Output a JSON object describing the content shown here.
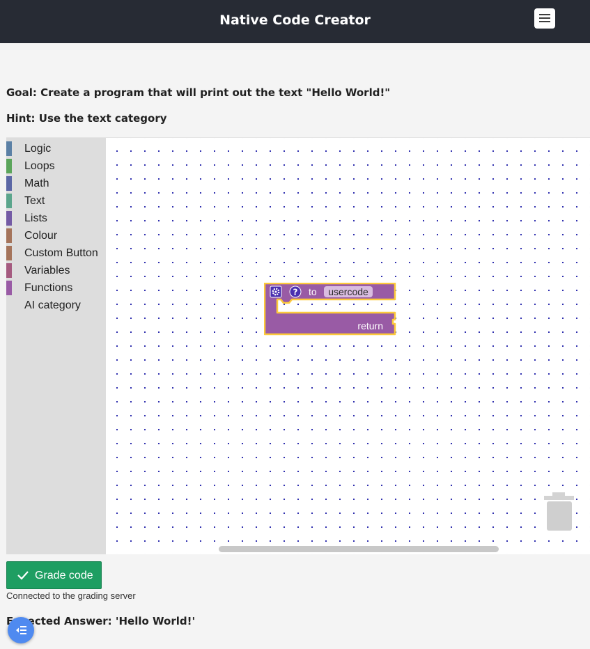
{
  "header": {
    "title": "Native Code Creator",
    "menu_icon": "hamburger-menu-icon"
  },
  "goal_text": "Goal: Create a program that will print out the text \"Hello World!\"",
  "hint_text": "Hint: Use the text category",
  "toolbox": {
    "categories": [
      {
        "label": "Logic",
        "color": "#5b80a5"
      },
      {
        "label": "Loops",
        "color": "#5ba55b"
      },
      {
        "label": "Math",
        "color": "#5b67a5"
      },
      {
        "label": "Text",
        "color": "#5ba58c"
      },
      {
        "label": "Lists",
        "color": "#745ba5"
      },
      {
        "label": "Colour",
        "color": "#a5745b"
      },
      {
        "label": "Custom Button",
        "color": "#a5745b"
      },
      {
        "label": "Variables",
        "color": "#a55b80"
      },
      {
        "label": "Functions",
        "color": "#995ba5"
      },
      {
        "label": "AI category",
        "color": ""
      }
    ]
  },
  "function_block": {
    "keyword": "to",
    "name": "usercode",
    "return_label": "return",
    "color": "#995ba5",
    "highlight": "#fcc93b"
  },
  "grade_button": {
    "label": "Grade code",
    "color": "#1e9e62"
  },
  "status_text": "Connected to the grading server",
  "expected_answer": "Expected Answer: 'Hello World!'"
}
